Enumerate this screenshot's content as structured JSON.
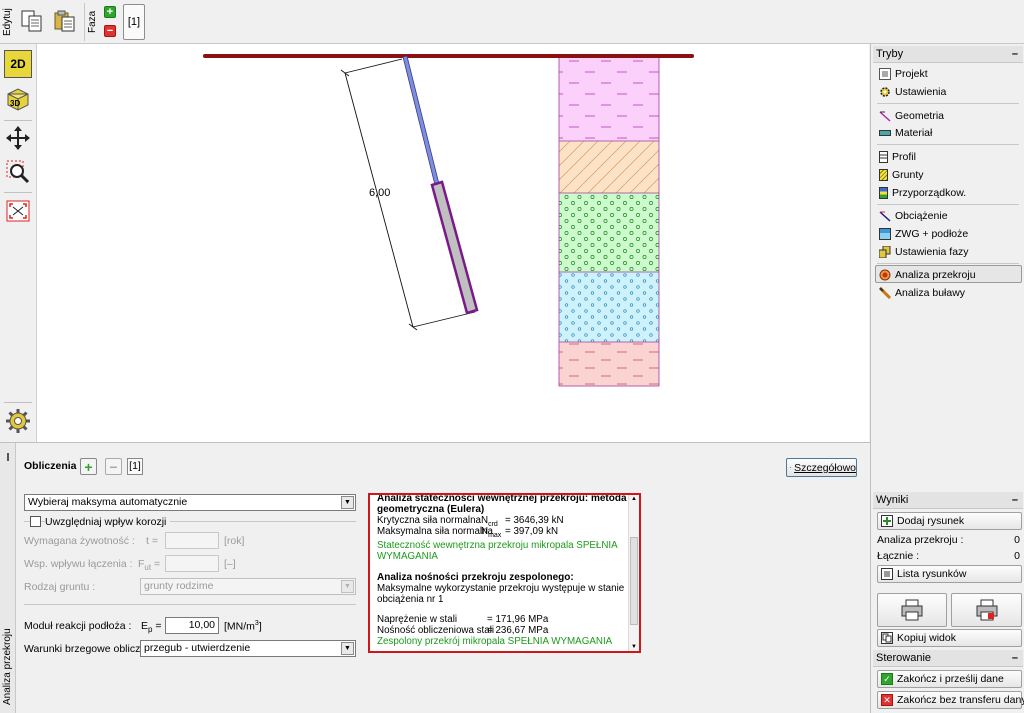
{
  "toolbar": {
    "edit_label": "Edytuj",
    "phase_label": "Faza",
    "phase_current": "[1]"
  },
  "canvas": {
    "dimension_label": "6,00"
  },
  "modes": {
    "header": "Tryby",
    "items": [
      {
        "label": "Projekt",
        "icon": "project-icon"
      },
      {
        "label": "Ustawienia",
        "icon": "settings-icon"
      },
      {
        "label": "Geometria",
        "icon": "geometry-icon"
      },
      {
        "label": "Materiał",
        "icon": "material-icon"
      },
      {
        "label": "Profil",
        "icon": "profile-icon"
      },
      {
        "label": "Grunty",
        "icon": "soils-icon"
      },
      {
        "label": "Przyporządkow.",
        "icon": "assign-icon"
      },
      {
        "label": "Obciążenie",
        "icon": "load-icon"
      },
      {
        "label": "ZWG + podłoże",
        "icon": "water-icon"
      },
      {
        "label": "Ustawienia fazy",
        "icon": "stage-settings-icon"
      },
      {
        "label": "Analiza przekroju",
        "icon": "cross-section-icon"
      },
      {
        "label": "Analiza buławy",
        "icon": "pile-analysis-icon"
      }
    ]
  },
  "results_panel": {
    "header": "Wyniki",
    "add_picture": "Dodaj rysunek",
    "analysis_label": "Analiza przekroju :",
    "analysis_count": "0",
    "total_label": "Łącznie :",
    "total_count": "0",
    "list_pictures": "Lista rysunków",
    "copy_view": "Kopiuj widok"
  },
  "control": {
    "header": "Sterowanie",
    "finish_send": "Zakończ i prześlij dane",
    "finish_no_transfer": "Zakończ bez transferu danych"
  },
  "calc": {
    "side_tab": "Analiza przekroju",
    "label": "Obliczenia :",
    "current": "[1]",
    "detail_button": "Szczegółowo",
    "mode_select": "Wybieraj maksyma automatycznie",
    "corrosion_checkbox": "Uwzględniaj wpływ korozji",
    "lifetime_label": "Wymagana żywotność :",
    "lifetime_sym": "t =",
    "lifetime_unit": "[rok]",
    "coef_label": "Wsp. wpływu łączenia :",
    "coef_sym": "F",
    "coef_sub": "ut",
    "coef_eq": " =",
    "coef_unit": "[–]",
    "soil_type_label": "Rodzaj gruntu :",
    "soil_type_value": "grunty rodzime",
    "modulus_label": "Moduł reakcji podłoża :",
    "modulus_sym": "E",
    "modulus_sub": "p",
    "modulus_eq": " =",
    "modulus_value": "10,00",
    "modulus_unit": "[MN/m",
    "modulus_unit_sup": "3",
    "modulus_unit_end": "]",
    "boundary_label": "Warunki brzegowe obliczeń :",
    "boundary_value": "przegub - utwierdzenie"
  },
  "results": {
    "title1": "Analiza stateczności wewnętrznej przekroju: metoda geometryczna (Eulera)",
    "crit_label": "Krytyczna siła normalna",
    "crit_sym": "N",
    "crit_sub": "crd",
    "crit_value": "=  3646,39  kN",
    "max_label": "Maksymalna siła normalna",
    "max_sym": "N",
    "max_sub": "max",
    "max_value": "=    397,09  kN",
    "stability_ok": "Stateczność wewnętrzna przekroju mikropala SPEŁNIA WYMAGANIA",
    "title2": "Analiza nośności przekroju zespolonego:",
    "max_util": "Maksymalne wykorzystanie przekroju występuje w stanie obciążenia nr 1",
    "stress_label": "Naprężenie w stali",
    "stress_value": "=  171,96  MPa",
    "capacity_label": "Nośność obliczeniowa stali",
    "capacity_value": "=  236,67  MPa",
    "composite_ok": "Zespolony przekrój mikropala SPEŁNIA WYMAGANIA"
  }
}
